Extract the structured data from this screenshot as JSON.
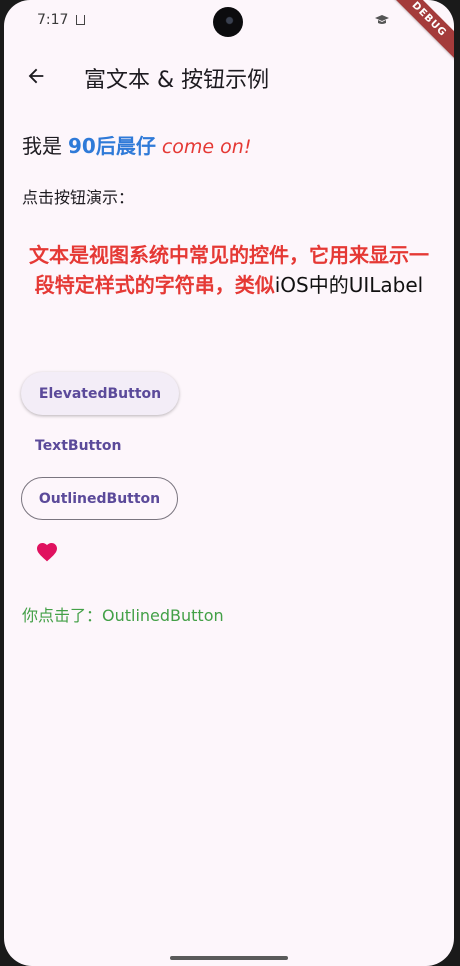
{
  "status_bar": {
    "time": "7:17"
  },
  "debug_banner": "DEBUG",
  "app_bar": {
    "title": "富文本 & 按钮示例",
    "back_icon": "arrow-back-icon"
  },
  "rich_text": {
    "prefix": "我是",
    "bold": "90后晨仔",
    "italic": "come on!"
  },
  "demo_label": "点击按钮演示：",
  "paragraph": {
    "red_part": "文本是视图系统中常见的控件，它用来显示一段特定样式的字符串，类似",
    "black_part": "iOS中的UILabel"
  },
  "buttons": {
    "elevated": "ElevatedButton",
    "text": "TextButton",
    "outlined": "OutlinedButton",
    "icon": "favorite-heart-icon"
  },
  "clicked_message": "你点击了：OutlinedButton",
  "colors": {
    "background": "#fdf6fb",
    "accent_blue": "#2f7ad8",
    "accent_red": "#e53935",
    "button_text": "#5b4a9a",
    "heart": "#e0115f",
    "message_green": "#43a047"
  }
}
